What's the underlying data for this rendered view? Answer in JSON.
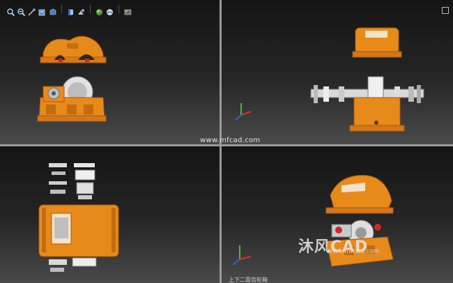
{
  "toolbar": {
    "icons": [
      "zoom-in-icon",
      "zoom-out-icon",
      "pan-icon",
      "rotate-icon",
      "view-orientation-icon",
      "section-view-icon",
      "display-style-icon",
      "appearance-icon",
      "scene-icon",
      "hide-show-icon"
    ]
  },
  "viewports": {
    "top_left": {
      "name": "front-view"
    },
    "top_right": {
      "name": "side-view"
    },
    "bottom_left": {
      "name": "top-view"
    },
    "bottom_right": {
      "name": "isometric-view"
    }
  },
  "watermark": {
    "text": "www.mfcad.com"
  },
  "logo": {
    "text": "沐风CAD",
    "subtext": "www.mfcad.com"
  },
  "caption": {
    "text": "上下二面齿轮箱"
  },
  "colors": {
    "housing": "#e88a1a",
    "housing_dark": "#a85a0a",
    "metal": "#d9d9d9",
    "axis_x": "#e0342b",
    "axis_y": "#3cc23c",
    "axis_z": "#3a5fe0"
  }
}
